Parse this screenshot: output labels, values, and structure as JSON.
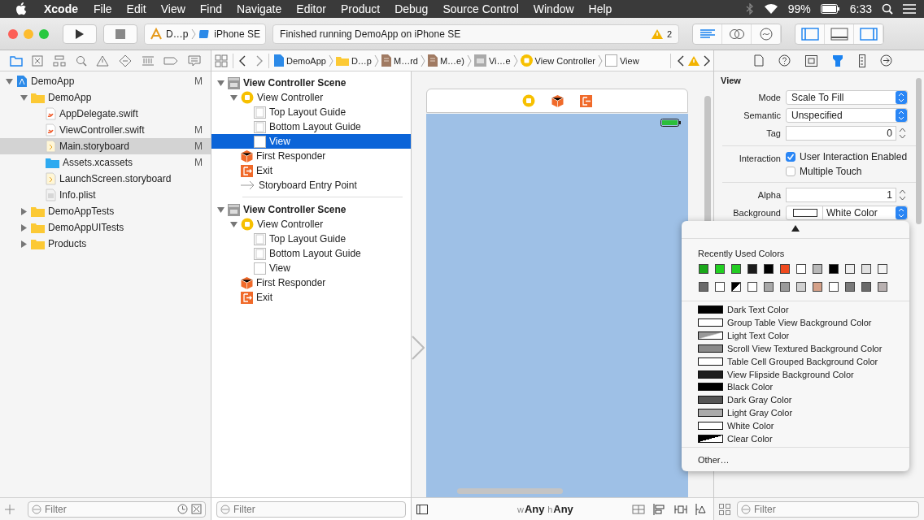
{
  "menu_bar": {
    "app": "Xcode",
    "items": [
      "File",
      "Edit",
      "View",
      "Find",
      "Navigate",
      "Editor",
      "Product",
      "Debug",
      "Source Control",
      "Window",
      "Help"
    ],
    "battery": "99%",
    "time": "6:33"
  },
  "toolbar": {
    "scheme": "D…p",
    "device": "iPhone SE",
    "status": "Finished running DemoApp on iPhone SE",
    "warning_count": "2"
  },
  "jump_bar": {
    "items": [
      {
        "kind": "project",
        "label": "DemoApp"
      },
      {
        "kind": "folder",
        "label": "D…p"
      },
      {
        "kind": "storyboard",
        "label": "M…rd"
      },
      {
        "kind": "storyboard",
        "label": "M…e)"
      },
      {
        "kind": "scene",
        "label": "Vi…e"
      },
      {
        "kind": "controller",
        "label": "View Controller"
      },
      {
        "kind": "view",
        "label": "View"
      }
    ]
  },
  "navigator": {
    "items": [
      {
        "kind": "project",
        "label": "DemoApp",
        "badge": "M",
        "expanded": true,
        "selected": false,
        "children": [
          {
            "kind": "folder",
            "label": "DemoApp",
            "expanded": true,
            "selected": false,
            "children": [
              {
                "kind": "swift",
                "label": "AppDelegate.swift",
                "selected": false
              },
              {
                "kind": "swift",
                "label": "ViewController.swift",
                "badge": "M",
                "selected": false
              },
              {
                "kind": "storyboard",
                "label": "Main.storyboard",
                "badge": "M",
                "selected": true
              },
              {
                "kind": "assets",
                "label": "Assets.xcassets",
                "badge": "M",
                "selected": false
              },
              {
                "kind": "storyboard",
                "label": "LaunchScreen.storyboard",
                "selected": false
              },
              {
                "kind": "plist",
                "label": "Info.plist",
                "selected": false
              }
            ]
          },
          {
            "kind": "folder",
            "label": "DemoAppTests",
            "expanded": false,
            "selected": false
          },
          {
            "kind": "folder",
            "label": "DemoAppUITests",
            "expanded": false,
            "selected": false
          },
          {
            "kind": "folder",
            "label": "Products",
            "expanded": false,
            "selected": false
          }
        ]
      }
    ],
    "filter_placeholder": "Filter"
  },
  "outline": {
    "scenes": [
      {
        "label": "View Controller Scene",
        "expanded": true,
        "children": [
          {
            "kind": "controller",
            "label": "View Controller",
            "expanded": true,
            "selected": false,
            "children": [
              {
                "kind": "guide",
                "label": "Top Layout Guide",
                "selected": false
              },
              {
                "kind": "guide",
                "label": "Bottom Layout Guide",
                "selected": false
              },
              {
                "kind": "view",
                "label": "View",
                "selected": true
              }
            ]
          },
          {
            "kind": "responder",
            "label": "First Responder",
            "selected": false
          },
          {
            "kind": "exit",
            "label": "Exit",
            "selected": false
          },
          {
            "kind": "entry",
            "label": "Storyboard Entry Point",
            "selected": false
          }
        ]
      },
      {
        "label": "View Controller Scene",
        "expanded": true,
        "children": [
          {
            "kind": "controller",
            "label": "View Controller",
            "expanded": true,
            "selected": false,
            "children": [
              {
                "kind": "guide",
                "label": "Top Layout Guide",
                "selected": false
              },
              {
                "kind": "guide",
                "label": "Bottom Layout Guide",
                "selected": false
              },
              {
                "kind": "view",
                "label": "View",
                "selected": false
              }
            ]
          },
          {
            "kind": "responder",
            "label": "First Responder",
            "selected": false
          },
          {
            "kind": "exit",
            "label": "Exit",
            "selected": false
          }
        ]
      }
    ],
    "filter_placeholder": "Filter"
  },
  "canvas": {
    "width_label": "w",
    "width_value": "Any",
    "height_label": "h",
    "height_value": "Any"
  },
  "inspector": {
    "section": "View",
    "groups": [
      [
        {
          "kind": "select",
          "label": "Mode",
          "value": "Scale To Fill"
        },
        {
          "kind": "select",
          "label": "Semantic",
          "value": "Unspecified"
        },
        {
          "kind": "stepper",
          "label": "Tag",
          "value": "0"
        }
      ],
      [
        {
          "kind": "checks",
          "label": "Interaction",
          "options": [
            {
              "label": "User Interaction Enabled",
              "checked": true
            },
            {
              "label": "Multiple Touch",
              "checked": false
            }
          ]
        }
      ],
      [
        {
          "kind": "stepper",
          "label": "Alpha",
          "value": "1"
        },
        {
          "kind": "color",
          "label": "Background",
          "value": "White Color",
          "color": "#ffffff"
        }
      ]
    ],
    "filter_placeholder": "Filter"
  },
  "color_popover": {
    "title": "Recently Used Colors",
    "swatches": [
      {
        "kind": "solid",
        "color": "#1aa81a"
      },
      {
        "kind": "solid",
        "color": "#22d022"
      },
      {
        "kind": "solid",
        "color": "#22cc22"
      },
      {
        "kind": "solid",
        "color": "#1a1a1a"
      },
      {
        "kind": "solid",
        "color": "#000000"
      },
      {
        "kind": "solid",
        "color": "#f04a1e"
      },
      {
        "kind": "solid",
        "color": "#ffffff"
      },
      {
        "kind": "solid",
        "color": "#b8b8b8"
      },
      {
        "kind": "solid",
        "color": "#000000"
      },
      {
        "kind": "solid",
        "color": "#eeeeee"
      },
      {
        "kind": "solid",
        "color": "#e0e0e0"
      },
      {
        "kind": "solid",
        "color": "#f4f4f4"
      },
      {
        "kind": "solid",
        "color": "#6a6a6a"
      },
      {
        "kind": "solid",
        "color": "#ffffff"
      },
      {
        "kind": "split",
        "color": "#000000"
      },
      {
        "kind": "solid",
        "color": "#ffffff"
      },
      {
        "kind": "solid",
        "color": "#a8a8a8"
      },
      {
        "kind": "solid",
        "color": "#9a9a9a"
      },
      {
        "kind": "solid",
        "color": "#d0d0d0"
      },
      {
        "kind": "solid",
        "color": "#d4a088"
      },
      {
        "kind": "solid",
        "color": "#ffffff"
      },
      {
        "kind": "solid",
        "color": "#7a7a7a"
      },
      {
        "kind": "solid",
        "color": "#6a6a6a"
      },
      {
        "kind": "solid",
        "color": "#b8b0b0"
      }
    ],
    "named": [
      {
        "kind": "solid",
        "label": "Dark Text Color",
        "color": "#000000"
      },
      {
        "kind": "solid",
        "label": "Group Table View Background Color",
        "color": "#ffffff"
      },
      {
        "kind": "gradient",
        "label": "Light Text Color",
        "color": "#999999"
      },
      {
        "kind": "solid",
        "label": "Scroll View Textured Background Color",
        "color": "#8a8a8a"
      },
      {
        "kind": "solid",
        "label": "Table Cell Grouped Background Color",
        "color": "#ffffff"
      },
      {
        "kind": "solid",
        "label": "View Flipside Background Color",
        "color": "#1e1e1e"
      },
      {
        "kind": "solid",
        "label": "Black Color",
        "color": "#000000"
      },
      {
        "kind": "solid",
        "label": "Dark Gray Color",
        "color": "#555555"
      },
      {
        "kind": "solid",
        "label": "Light Gray Color",
        "color": "#aaaaaa"
      },
      {
        "kind": "solid",
        "label": "White Color",
        "color": "#ffffff"
      },
      {
        "kind": "split",
        "label": "Clear Color",
        "color": "#000000"
      }
    ],
    "other": "Other…"
  }
}
